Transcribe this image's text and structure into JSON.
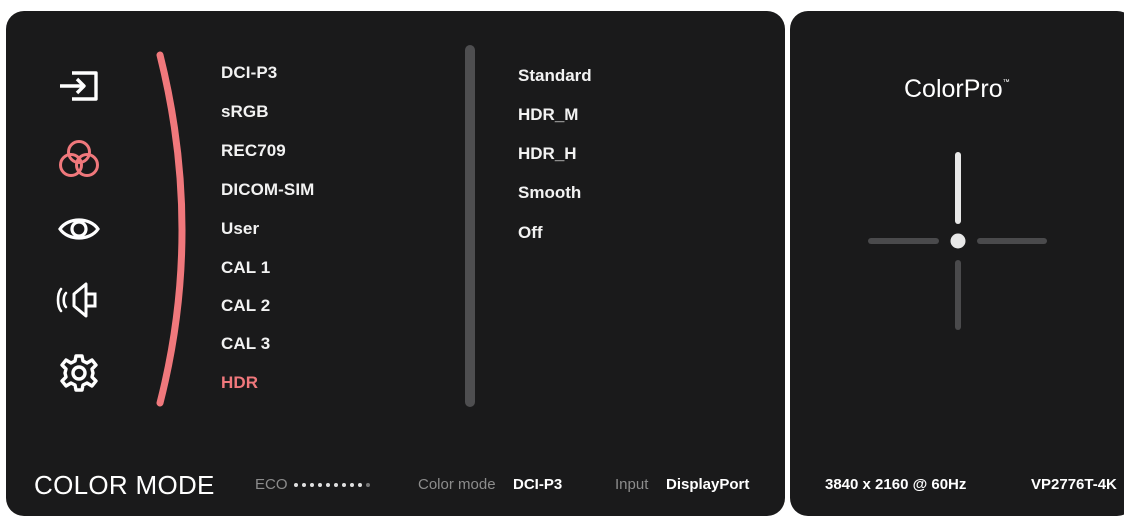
{
  "colors": {
    "accent": "#f0787c",
    "panel_bg": "#1a1a1b",
    "text": "#f2f2f2",
    "muted": "#8c8c8c"
  },
  "nav_icons": [
    {
      "name": "input-icon",
      "active": false
    },
    {
      "name": "color-adjust-icon",
      "active": true
    },
    {
      "name": "view-mode-icon",
      "active": false
    },
    {
      "name": "audio-icon",
      "active": false
    },
    {
      "name": "settings-icon",
      "active": false
    }
  ],
  "menu": {
    "items": [
      {
        "label": "DCI-P3"
      },
      {
        "label": "sRGB"
      },
      {
        "label": "REC709"
      },
      {
        "label": "DICOM-SIM"
      },
      {
        "label": "User"
      },
      {
        "label": "CAL 1"
      },
      {
        "label": "CAL 2"
      },
      {
        "label": "CAL 3"
      },
      {
        "label": "HDR"
      }
    ],
    "selected": "HDR"
  },
  "submenu": {
    "items": [
      {
        "label": "Standard"
      },
      {
        "label": "HDR_M"
      },
      {
        "label": "HDR_H"
      },
      {
        "label": "Smooth"
      },
      {
        "label": "Off"
      }
    ]
  },
  "footer": {
    "title": "COLOR MODE",
    "eco_label": "ECO",
    "eco_level": 0.9,
    "color_mode_label": "Color mode",
    "color_mode_value": "DCI-P3",
    "input_label": "Input",
    "input_value": "DisplayPort"
  },
  "side": {
    "brand": "ColorPro",
    "brand_mark": "™",
    "resolution": "3840 x 2160 @ 60Hz",
    "model": "VP2776T-4K"
  }
}
